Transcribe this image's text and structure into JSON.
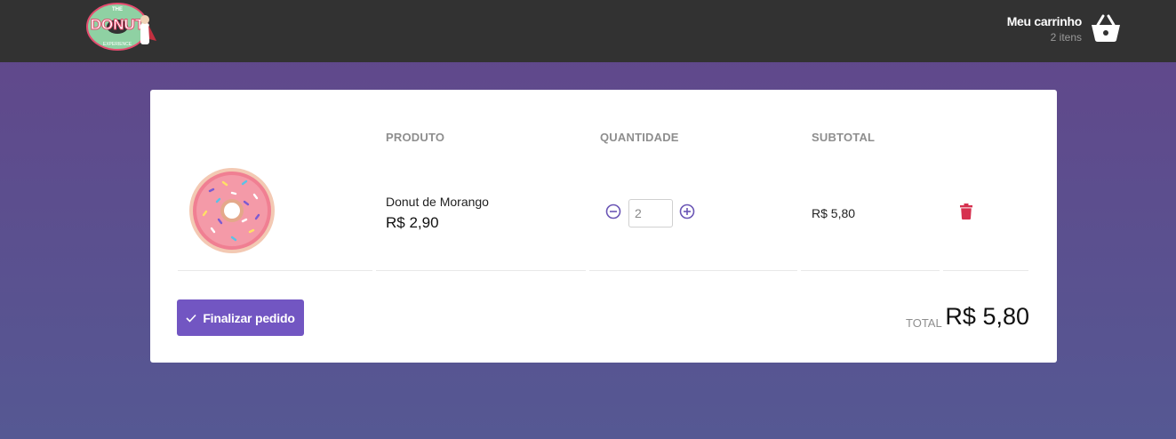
{
  "header": {
    "logo_text": "DONUT",
    "logo_small_top": "THE",
    "logo_small_bottom": "EXPERIENCE",
    "cart_title": "Meu carrinho",
    "cart_count": "2 itens"
  },
  "table": {
    "headers": [
      "PRODUTO",
      "QUANTIDADE",
      "SUBTOTAL"
    ],
    "items": [
      {
        "name": "Donut de Morango",
        "price": "R$ 2,90",
        "quantity": "2",
        "subtotal": "R$ 5,80",
        "image_icon": "strawberry-donut-image"
      }
    ]
  },
  "footer": {
    "finish_label": "Finalizar pedido",
    "total_label": "TOTAL",
    "total_value": "R$ 5,80"
  },
  "colors": {
    "topbar": "#323232",
    "accent": "#7256c2",
    "delete": "#d6314f",
    "qty_icon": "#6a55b5"
  },
  "icons": {
    "cart": "basket-icon",
    "minus": "minus-circle-icon",
    "plus": "plus-circle-icon",
    "delete": "trash-icon",
    "check": "check-icon"
  }
}
